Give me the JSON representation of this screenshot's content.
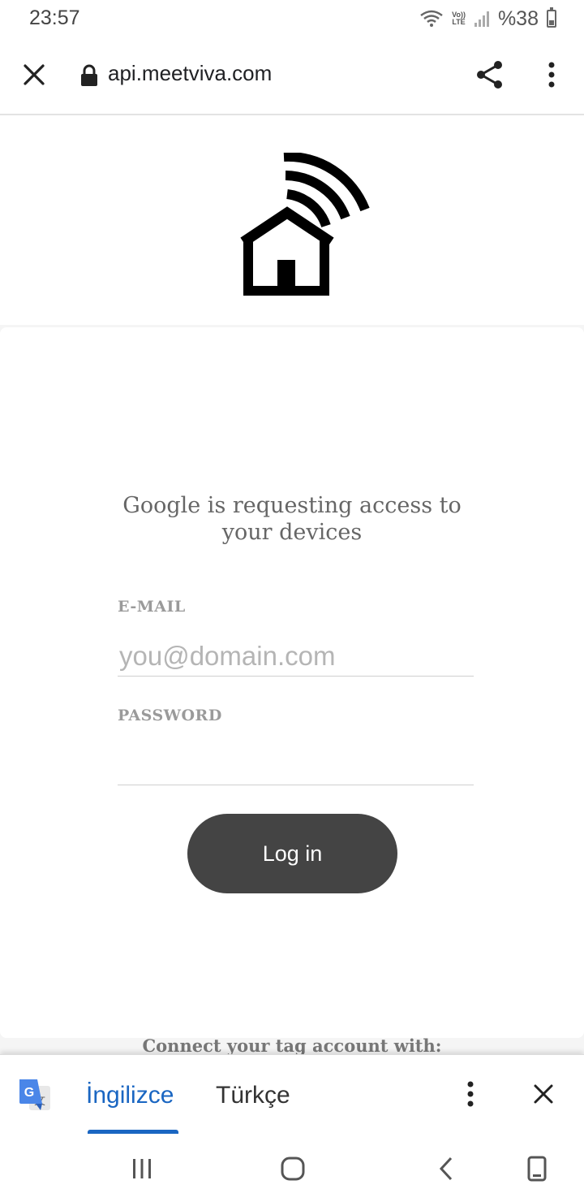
{
  "status_bar": {
    "time": "23:57",
    "network": "Vo))\nLTE",
    "battery": "%38",
    "battery_level_percent": 38,
    "icons": [
      "wifi-icon",
      "volte-icon",
      "signal-icon",
      "battery-icon"
    ]
  },
  "toolbar": {
    "url": "api.meetviva.com",
    "icons": [
      "close-icon",
      "lock-icon",
      "share-icon",
      "more-vert-icon"
    ]
  },
  "page": {
    "logo_icon": "smart-home-wifi-icon",
    "request_line1": "Google is requesting access to",
    "request_line2": "your devices",
    "email_label": "E-MAIL",
    "email_value": "",
    "email_placeholder": "you@domain.com",
    "password_label": "PASSWORD",
    "password_value": "",
    "password_placeholder": "",
    "login_label": "Log in",
    "connect_text": "Connect your tag account with:"
  },
  "translate_bar": {
    "icon": "google-translate-icon",
    "active_language": "İngilizce",
    "other_language": "Türkçe",
    "icons": [
      "more-vert-icon",
      "close-icon"
    ]
  },
  "nav_bar": {
    "icons": [
      "recent-apps-icon",
      "home-icon",
      "back-icon",
      "rotate-icon"
    ]
  },
  "colors": {
    "accent": "#1a66c2",
    "button": "#444444",
    "label": "#9a9a9a",
    "page_bg": "#f5f5f5"
  }
}
